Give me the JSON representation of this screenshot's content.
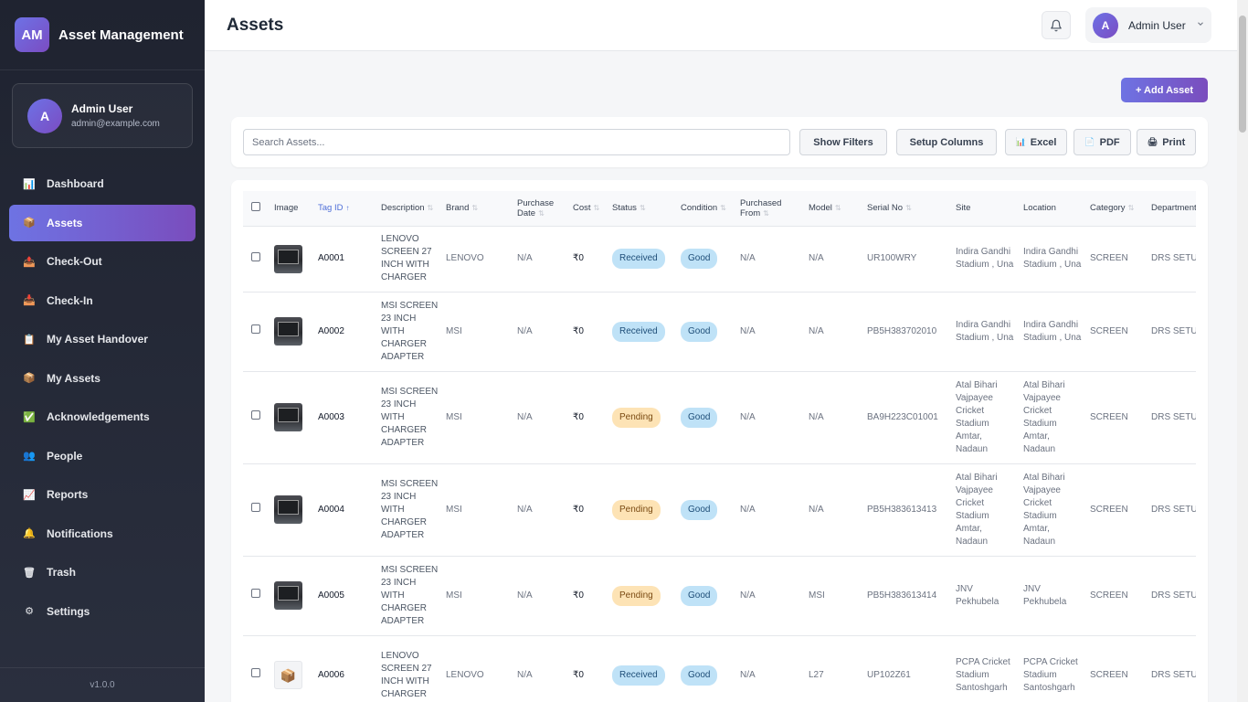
{
  "brand": {
    "logo": "AM",
    "name": "Asset Management"
  },
  "sidebar_user": {
    "initial": "A",
    "name": "Admin User",
    "email": "admin@example.com"
  },
  "nav": [
    {
      "label": "Dashboard",
      "icon": "dashboard-icon",
      "glyph": "📊"
    },
    {
      "label": "Assets",
      "icon": "box-icon",
      "glyph": "📦"
    },
    {
      "label": "Check-Out",
      "icon": "checkout-icon",
      "glyph": "📤"
    },
    {
      "label": "Check-In",
      "icon": "checkin-icon",
      "glyph": "📥"
    },
    {
      "label": "My Asset Handover",
      "icon": "clipboard-icon",
      "glyph": "📋"
    },
    {
      "label": "My Assets",
      "icon": "box-icon",
      "glyph": "📦"
    },
    {
      "label": "Acknowledgements",
      "icon": "check-icon",
      "glyph": "✅"
    },
    {
      "label": "People",
      "icon": "people-icon",
      "glyph": "👥"
    },
    {
      "label": "Reports",
      "icon": "chart-icon",
      "glyph": "📈"
    },
    {
      "label": "Notifications",
      "icon": "bell-icon",
      "glyph": "🔔"
    },
    {
      "label": "Trash",
      "icon": "trash-icon",
      "glyph": "🗑"
    },
    {
      "label": "Settings",
      "icon": "gear-icon",
      "glyph": "⚙"
    }
  ],
  "version": "v1.0.0",
  "header": {
    "title": "Assets",
    "user_initial": "A",
    "user_name": "Admin User"
  },
  "actions": {
    "add_asset": "+ Add Asset"
  },
  "toolbar": {
    "search_placeholder": "Search Assets...",
    "show_filters": "Show Filters",
    "setup_columns": "Setup Columns",
    "excel": "Excel",
    "pdf": "PDF",
    "print": "Print"
  },
  "table": {
    "columns": [
      "Image",
      "Tag ID",
      "Description",
      "Brand",
      "Purchase Date",
      "Cost",
      "Status",
      "Condition",
      "Purchased From",
      "Model",
      "Serial No",
      "Site",
      "Location",
      "Category",
      "Department"
    ],
    "rows": [
      {
        "thumb": "photo",
        "tag": "A0001",
        "description": "LENOVO SCREEN 27 INCH WITH CHARGER",
        "brand": "LENOVO",
        "purchase_date": "N/A",
        "cost": "₹0",
        "status": "Received",
        "condition": "Good",
        "purchased_from": "N/A",
        "model": "N/A",
        "serial": "UR100WRY",
        "site": "Indira Gandhi Stadium , Una",
        "location": "Indira Gandhi Stadium , Una",
        "category": "SCREEN",
        "department": "DRS SETUP"
      },
      {
        "thumb": "photo",
        "tag": "A0002",
        "description": "MSI SCREEN 23 INCH WITH CHARGER ADAPTER",
        "brand": "MSI",
        "purchase_date": "N/A",
        "cost": "₹0",
        "status": "Received",
        "condition": "Good",
        "purchased_from": "N/A",
        "model": "N/A",
        "serial": "PB5H383702010",
        "site": "Indira Gandhi Stadium , Una",
        "location": "Indira Gandhi Stadium , Una",
        "category": "SCREEN",
        "department": "DRS SETUP"
      },
      {
        "thumb": "photo",
        "tag": "A0003",
        "description": "MSI SCREEN 23 INCH WITH CHARGER ADAPTER",
        "brand": "MSI",
        "purchase_date": "N/A",
        "cost": "₹0",
        "status": "Pending",
        "condition": "Good",
        "purchased_from": "N/A",
        "model": "N/A",
        "serial": "BA9H223C01001",
        "site": "Atal Bihari Vajpayee Cricket Stadium Amtar, Nadaun",
        "location": "Atal Bihari Vajpayee Cricket Stadium Amtar, Nadaun",
        "category": "SCREEN",
        "department": "DRS SETUP"
      },
      {
        "thumb": "photo",
        "tag": "A0004",
        "description": "MSI SCREEN 23 INCH WITH CHARGER ADAPTER",
        "brand": "MSI",
        "purchase_date": "N/A",
        "cost": "₹0",
        "status": "Pending",
        "condition": "Good",
        "purchased_from": "N/A",
        "model": "N/A",
        "serial": "PB5H383613413",
        "site": "Atal Bihari Vajpayee Cricket Stadium Amtar, Nadaun",
        "location": "Atal Bihari Vajpayee Cricket Stadium Amtar, Nadaun",
        "category": "SCREEN",
        "department": "DRS SETUP"
      },
      {
        "thumb": "photo",
        "tag": "A0005",
        "description": "MSI SCREEN 23 INCH WITH CHARGER ADAPTER",
        "brand": "MSI",
        "purchase_date": "N/A",
        "cost": "₹0",
        "status": "Pending",
        "condition": "Good",
        "purchased_from": "N/A",
        "model": "MSI",
        "serial": "PB5H383613414",
        "site": "JNV Pekhubela",
        "location": "JNV Pekhubela",
        "category": "SCREEN",
        "department": "DRS SETUP"
      },
      {
        "thumb": "box",
        "tag": "A0006",
        "description": "LENOVO SCREEN 27 INCH WITH CHARGER",
        "brand": "LENOVO",
        "purchase_date": "N/A",
        "cost": "₹0",
        "status": "Received",
        "condition": "Good",
        "purchased_from": "N/A",
        "model": "L27",
        "serial": "UP102Z61",
        "site": "PCPA Cricket Stadium Santoshgarh",
        "location": "PCPA Cricket Stadium Santoshgarh",
        "category": "SCREEN",
        "department": "DRS SETUP"
      }
    ]
  },
  "colors": {
    "accent": "#6e73e3",
    "accent2": "#7a4dbd",
    "sidebar": "#1f2330",
    "badge_blue": "#bfe2f7",
    "badge_amber": "#fde3b5"
  }
}
